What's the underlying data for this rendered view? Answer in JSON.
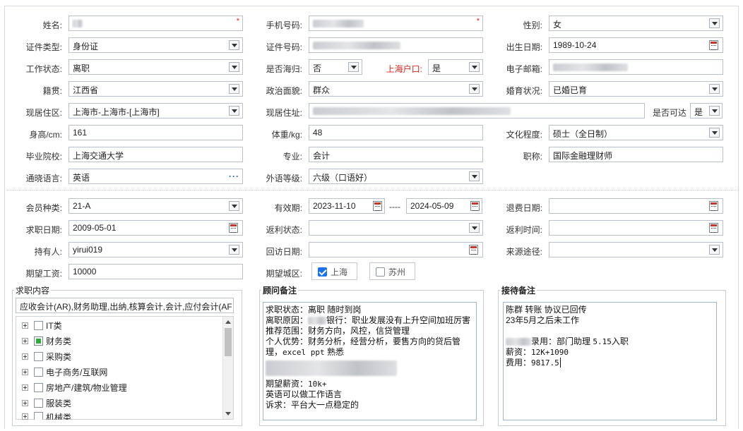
{
  "row1": {
    "name_label": "姓名:",
    "name_value": "",
    "phone_label": "手机号码:",
    "phone_value": "",
    "gender_label": "性别:",
    "gender_value": "女"
  },
  "row2": {
    "idtype_label": "证件类型:",
    "idtype_value": "身份证",
    "idno_label": "证件号码:",
    "idno_value": "",
    "birth_label": "出生日期:",
    "birth_value": "1989-10-24"
  },
  "row3": {
    "work_label": "工作状态:",
    "work_value": "离职",
    "overseas_label": "是否海归:",
    "overseas_value": "否",
    "hukou_label": "上海户口:",
    "hukou_value": "是",
    "email_label": "电子邮箱:",
    "email_value": ""
  },
  "row4": {
    "native_label": "籍贯:",
    "native_value": "江西省",
    "political_label": "政治面貌:",
    "political_value": "群众",
    "marital_label": "婚育状况:",
    "marital_value": "已婚已育"
  },
  "row5": {
    "region_label": "现居住区:",
    "region_value": "上海市-上海市-[上海市]",
    "address_label": "现居住址:",
    "address_value": "",
    "reachable_label": "是否可达",
    "reachable_value": "是"
  },
  "row6": {
    "height_label": "身高/cm:",
    "height_value": "161",
    "weight_label": "体重/kg:",
    "weight_value": "48",
    "edu_label": "文化程度:",
    "edu_value": "硕士（全日制）"
  },
  "row7": {
    "school_label": "毕业院校:",
    "school_value": "上海交通大学",
    "major_label": "专业:",
    "major_value": "会计",
    "title_label": "职称:",
    "title_value": "国际金融理财师"
  },
  "row8": {
    "lang_label": "通晓语言:",
    "lang_value": "英语",
    "langlevel_label": "外语等级:",
    "langlevel_value": "六级（口语好）"
  },
  "row9": {
    "member_label": "会员种类:",
    "member_value": "21-A",
    "valid_label": "有效期:",
    "valid_from": "2023-11-10",
    "valid_sep": "----",
    "valid_to": "2024-05-09",
    "refund_label": "退费日期:",
    "refund_value": ""
  },
  "row10": {
    "jobdate_label": "求职日期:",
    "jobdate_value": "2009-05-01",
    "rebate_label": "返利状态:",
    "rebate_value": "",
    "rebatetime_label": "返利时间:",
    "rebatetime_value": ""
  },
  "row11": {
    "holder_label": "持有人:",
    "holder_value": "yirui019",
    "visit_label": "回访日期:",
    "visit_value": "",
    "source_label": "来源途径:",
    "source_value": ""
  },
  "row12": {
    "salary_label": "期望工资:",
    "salary_value": "10000",
    "city_label": "期望城区:",
    "city1": "上海",
    "city1_checked": true,
    "city2": "苏州",
    "city2_checked": false
  },
  "job_panel": {
    "title": "求职内容",
    "summary": "应收会计(AR),财务助理,出纳,核算会计,会计,应付会计(AF",
    "tree": [
      {
        "label": "IT类",
        "checked": false
      },
      {
        "label": "财务类",
        "checked": true
      },
      {
        "label": "采购类",
        "checked": false
      },
      {
        "label": "电子商务/互联网",
        "checked": false
      },
      {
        "label": "房地产/建筑/物业管理",
        "checked": false
      },
      {
        "label": "服装类",
        "checked": false
      },
      {
        "label": "机械类",
        "checked": false
      }
    ]
  },
  "advisor_panel": {
    "title": "顾问备注",
    "lines": [
      "求职状态：离职  随时到岗",
      "离职原因：      银行：职业发展没有上升空间加班厉害",
      "推荐范围：财务方向，风控，信贷管理",
      "个人优势：财务分析，经营分析，要售方向的贷后管",
      "理，excel ppt 熟悉",
      "期望薪资：10k+",
      "英语可以做工作语言",
      "诉求：平台大一点稳定的"
    ]
  },
  "reception_panel": {
    "title": "接待备注",
    "lines": [
      "陈群 转账 协议已回传",
      "23年5月之后未工作",
      "",
      "录用：部门助理  5.15入职",
      "薪资：12K+1090",
      "费用：9817.5"
    ]
  },
  "colors": {
    "required": "#e2231a",
    "label_red": "#e2231a",
    "border": "#b9c1cc",
    "check_blue": "#1a73e8",
    "check_green": "#2eab3a"
  }
}
